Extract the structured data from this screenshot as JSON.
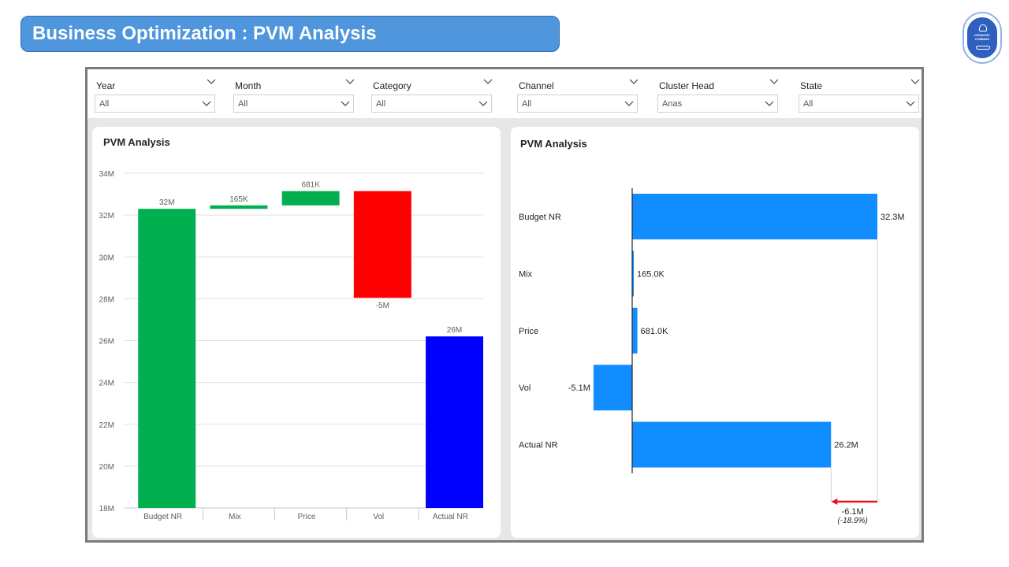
{
  "header": {
    "title": "Business Optimization : PVM Analysis"
  },
  "logo": {
    "icon": "company-logo-icon",
    "text": "CRUNCHY COMMAS"
  },
  "filters": [
    {
      "label": "Year",
      "value": "All"
    },
    {
      "label": "Month",
      "value": "All"
    },
    {
      "label": "Category",
      "value": "All"
    },
    {
      "label": "Channel",
      "value": "All"
    },
    {
      "label": "Cluster Head",
      "value": "Anas"
    },
    {
      "label": "State",
      "value": "All"
    }
  ],
  "colors": {
    "accent": "#4f96dd",
    "positive": "#00b050",
    "negative": "#ff0000",
    "total": "#0000ff",
    "bar_right": "#118dff",
    "delta": "#e81123"
  },
  "chart_data": [
    {
      "type": "bar",
      "title": "PVM Analysis",
      "subtype": "waterfall",
      "categories": [
        "Budget NR",
        "Mix",
        "Price",
        "Vol",
        "Actual NR"
      ],
      "values": [
        32.3,
        0.165,
        0.681,
        -5.1,
        26.2
      ],
      "kinds": [
        "total",
        "increase",
        "increase",
        "decrease",
        "total"
      ],
      "data_labels": [
        "32M",
        "165K",
        "681K",
        "-5M",
        "26M"
      ],
      "ylim": [
        18,
        34
      ],
      "y_ticks": [
        "18M",
        "20M",
        "22M",
        "24M",
        "26M",
        "28M",
        "30M",
        "32M",
        "34M"
      ],
      "grid": true
    },
    {
      "type": "bar",
      "title": "PVM Analysis",
      "orientation": "horizontal",
      "categories": [
        "Budget NR",
        "Mix",
        "Price",
        "Vol",
        "Actual NR"
      ],
      "values": [
        32.3,
        0.165,
        0.681,
        -5.1,
        26.2
      ],
      "data_labels": [
        "32.3M",
        "165.0K",
        "681.0K",
        "-5.1M",
        "26.2M"
      ],
      "variance": {
        "label": "-6.1M",
        "percent": "(-18.9%)"
      },
      "grid": false
    }
  ]
}
